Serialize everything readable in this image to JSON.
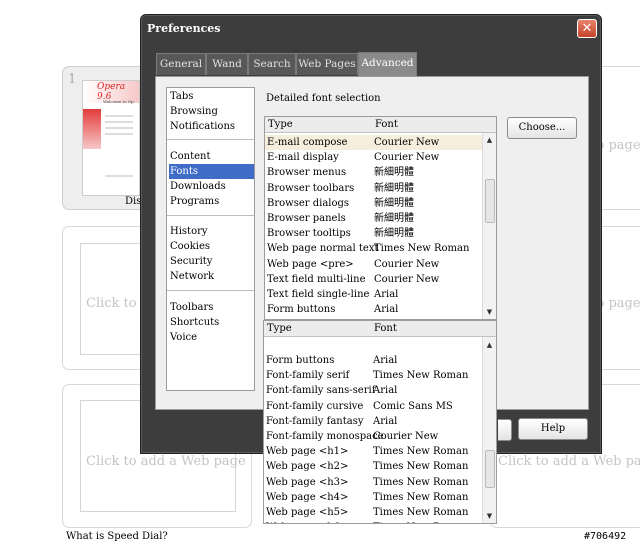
{
  "speed_dial": {
    "cells": [
      {
        "number": "1",
        "label": "Dis"
      },
      {
        "placeholder": "Click to"
      },
      {
        "placeholder": "Click to add a Web page"
      },
      {
        "placeholder": "b page"
      },
      {
        "placeholder": "b page"
      },
      {
        "placeholder": "Click to add a Web page"
      }
    ],
    "thumb_logo": "Opera 9.6",
    "thumb_welcome": "Welcome to Op",
    "footer_link": "What is Speed Dial?",
    "watermark": "#706492"
  },
  "dialog": {
    "title": "Preferences",
    "close_glyph": "✕",
    "tabs": [
      {
        "label": "General"
      },
      {
        "label": "Wand"
      },
      {
        "label": "Search"
      },
      {
        "label": "Web Pages"
      },
      {
        "label": "Advanced"
      }
    ],
    "categories": [
      "Tabs",
      "Browsing",
      "Notifications",
      "Content",
      "Fonts",
      "Downloads",
      "Programs",
      "History",
      "Cookies",
      "Security",
      "Network",
      "Toolbars",
      "Shortcuts",
      "Voice"
    ],
    "selected_category": "Fonts",
    "section_title": "Detailed font selection",
    "columns": {
      "type": "Type",
      "font": "Font"
    },
    "upper_rows": [
      {
        "type": "E-mail compose",
        "font": "Courier New"
      },
      {
        "type": "E-mail display",
        "font": "Courier New"
      },
      {
        "type": "Browser menus",
        "font": "新細明體"
      },
      {
        "type": "Browser toolbars",
        "font": "新細明體"
      },
      {
        "type": "Browser dialogs",
        "font": "新細明體"
      },
      {
        "type": "Browser panels",
        "font": "新細明體"
      },
      {
        "type": "Browser tooltips",
        "font": "新細明體"
      },
      {
        "type": "Web page normal text",
        "font": "Times New Roman"
      },
      {
        "type": "Web page <pre>",
        "font": "Courier New"
      },
      {
        "type": "Text field multi-line",
        "font": "Courier New"
      },
      {
        "type": "Text field single-line",
        "font": "Arial"
      },
      {
        "type": "Form buttons",
        "font": "Arial"
      }
    ],
    "lower_rows": [
      {
        "type": "Form buttons",
        "font": "Arial"
      },
      {
        "type": "Font-family serif",
        "font": "Times New Roman"
      },
      {
        "type": "Font-family sans-serif",
        "font": "Arial"
      },
      {
        "type": "Font-family cursive",
        "font": "Comic Sans MS"
      },
      {
        "type": "Font-family fantasy",
        "font": "Arial"
      },
      {
        "type": "Font-family monospace",
        "font": "Courier New"
      },
      {
        "type": "Web page <h1>",
        "font": "Times New Roman"
      },
      {
        "type": "Web page <h2>",
        "font": "Times New Roman"
      },
      {
        "type": "Web page <h3>",
        "font": "Times New Roman"
      },
      {
        "type": "Web page <h4>",
        "font": "Times New Roman"
      },
      {
        "type": "Web page <h5>",
        "font": "Times New Roman"
      },
      {
        "type": "Web page <h6>",
        "font": "Times New Roman"
      }
    ],
    "choose_button": "Choose...",
    "help_button": "Help",
    "colors": {
      "titlebar": "#3d3d3d",
      "selection": "#3e6cc6",
      "close": "#d9563b"
    }
  }
}
